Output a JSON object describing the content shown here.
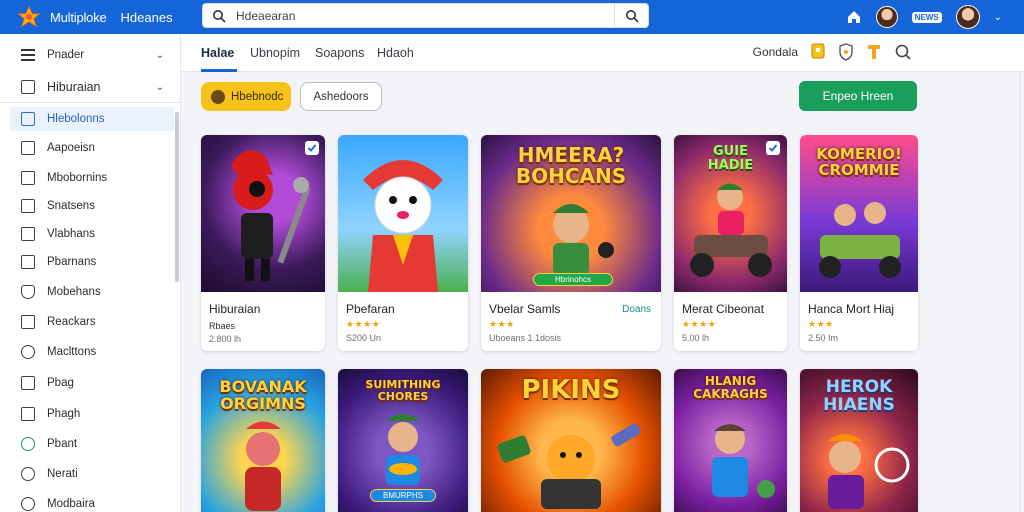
{
  "app": {
    "title": "Multiploke",
    "subtitle": "Hdeanes"
  },
  "search": {
    "value": "Hdeaearan",
    "placeholder": ""
  },
  "topbar": {
    "badge": "NEWS"
  },
  "sidebar": {
    "items": [
      {
        "label": "Pnader",
        "icon": "menu-icon"
      },
      {
        "label": "Hiburaian",
        "icon": "grid-icon"
      },
      {
        "label": "Hlebolonns",
        "icon": "library-icon"
      },
      {
        "label": "Aapoeisn",
        "icon": "list-icon"
      },
      {
        "label": "Mbobornins",
        "icon": "window-icon"
      },
      {
        "label": "Snatsens",
        "icon": "bookmark-icon"
      },
      {
        "label": "Vlabhans",
        "icon": "calendar-icon"
      },
      {
        "label": "Pbarnans",
        "icon": "card-icon"
      },
      {
        "label": "Mobehans",
        "icon": "shield-icon"
      },
      {
        "label": "Reackars",
        "icon": "trophy-icon"
      },
      {
        "label": "Maclttons",
        "icon": "settings-icon"
      },
      {
        "label": "Pbag",
        "icon": "bag-icon"
      },
      {
        "label": "Phagh",
        "icon": "tag-icon"
      },
      {
        "label": "Pbant",
        "icon": "globe-icon"
      },
      {
        "label": "Nerati",
        "icon": "user-icon"
      },
      {
        "label": "Modbaira",
        "icon": "help-icon"
      }
    ]
  },
  "tabs": [
    {
      "label": "Halae"
    },
    {
      "label": "Ubnopim"
    },
    {
      "label": "Soapons"
    },
    {
      "label": "Hdaoh"
    }
  ],
  "toolbar": {
    "right_label": "Gondala"
  },
  "filters": {
    "chip1": "Hbebnodc",
    "chip2": "Ashedoors",
    "primary": "Enpeo Hreen"
  },
  "cards_row1": [
    {
      "name": "Hiburaian",
      "sub": "Rbaes",
      "meta": "2.800 lh",
      "stars": "",
      "action": "",
      "art_title": ""
    },
    {
      "name": "Pbefaran",
      "sub": "",
      "meta": "S200 Un",
      "stars": "★★★★",
      "action": "",
      "art_title": ""
    },
    {
      "name": "Vbelar Samls",
      "sub": "",
      "meta": "Uboeans 1 1dosis",
      "stars": "★★★",
      "action": "Doans",
      "art_title": "HMEERA?\nBOHCANS",
      "pill": "Hbrinohcs"
    },
    {
      "name": "Merat Cibeonat",
      "sub": "",
      "meta": "5.00 lh",
      "stars": "★★★★",
      "action": "",
      "art_title": "GUIE\nHADIE"
    },
    {
      "name": "Hanca Mort Hiaj",
      "sub": "",
      "meta": "2.50 Im",
      "stars": "★★★",
      "action": "",
      "art_title": "KOMERIO!\nCROMMIE"
    }
  ],
  "cards_row2": [
    {
      "art_title": "BOVANAK\nORGIMNS"
    },
    {
      "art_title": "SUIMITHING\nCHORES",
      "pill": "BMURPHS"
    },
    {
      "art_title": "PIKINS"
    },
    {
      "art_title": "HLANIG\nCAKRAGHS"
    },
    {
      "art_title": "HEROK\nHIAENS"
    }
  ],
  "colors": {
    "topbar": "#1565d8",
    "primary_button": "#1a9e5c",
    "chip_yellow": "#f7c21a",
    "accent_star": "#f0a300"
  }
}
